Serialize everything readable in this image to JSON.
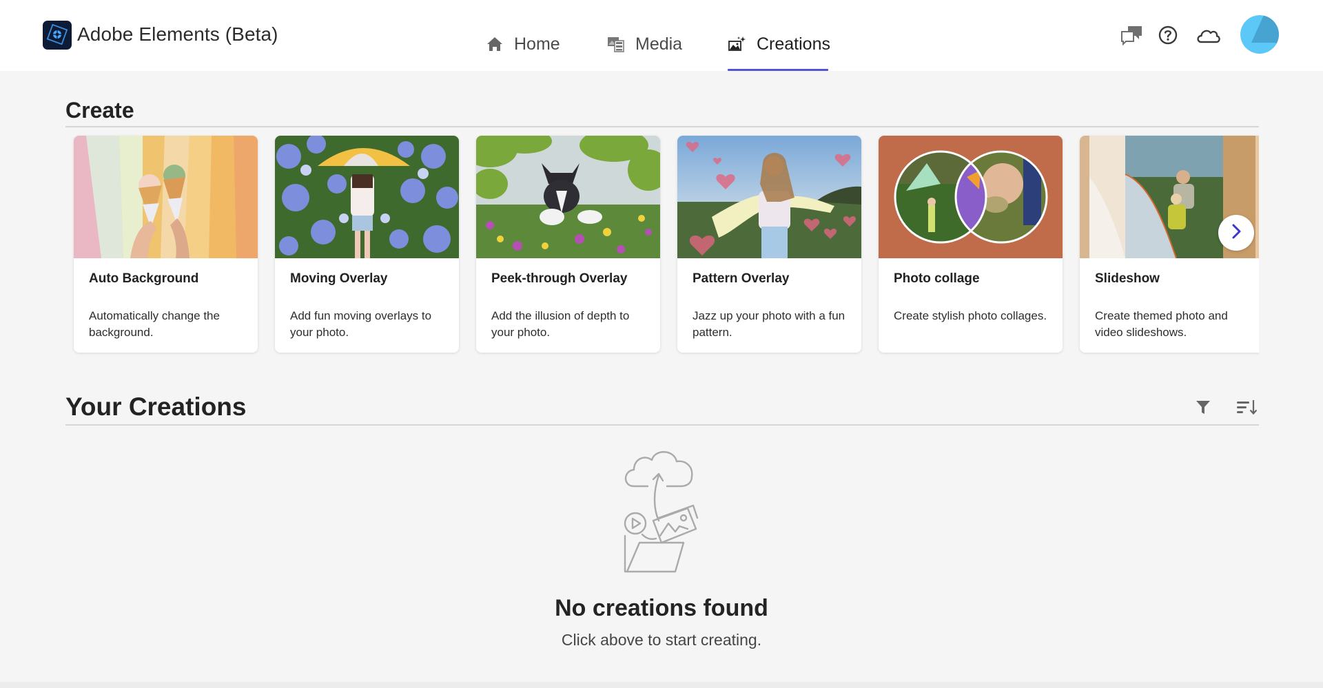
{
  "header": {
    "app_title": "Adobe Elements (Beta)",
    "logo_icon": "adobe-elements-logo",
    "nav": [
      {
        "label": "Home",
        "icon": "home-icon",
        "active": false
      },
      {
        "label": "Media",
        "icon": "media-icon",
        "active": false
      },
      {
        "label": "Creations",
        "icon": "creations-icon",
        "active": true
      }
    ],
    "actions": [
      {
        "icon": "feedback-chat-icon"
      },
      {
        "icon": "help-icon"
      },
      {
        "icon": "cloud-icon"
      },
      {
        "icon": "avatar"
      }
    ],
    "accent_color": "#5455d6"
  },
  "create": {
    "title": "Create",
    "cards": [
      {
        "title": "Auto Background",
        "description": "Automatically change the background.",
        "image": "ice-cream-cones-on-color-stripes"
      },
      {
        "title": "Moving Overlay",
        "description": "Add fun moving overlays to your photo.",
        "image": "girl-with-umbrella-in-hydrangeas"
      },
      {
        "title": "Peek-through Overlay",
        "description": "Add the illusion of depth to your photo.",
        "image": "puppy-in-wildflowers"
      },
      {
        "title": "Pattern Overlay",
        "description": "Jazz up your photo with a fun pattern.",
        "image": "woman-in-field-with-hearts"
      },
      {
        "title": "Photo collage",
        "description": "Create stylish photo collages.",
        "image": "two-circle-photo-collage"
      },
      {
        "title": "Slideshow",
        "description": "Create themed photo and video slideshows.",
        "image": "family-setting-up-tent"
      }
    ],
    "next_button_icon": "chevron-right-icon"
  },
  "your_creations": {
    "title": "Your Creations",
    "filter_icon": "filter-icon",
    "sort_icon": "sort-icon",
    "empty_title": "No creations found",
    "empty_subtitle": "Click above to start creating."
  }
}
